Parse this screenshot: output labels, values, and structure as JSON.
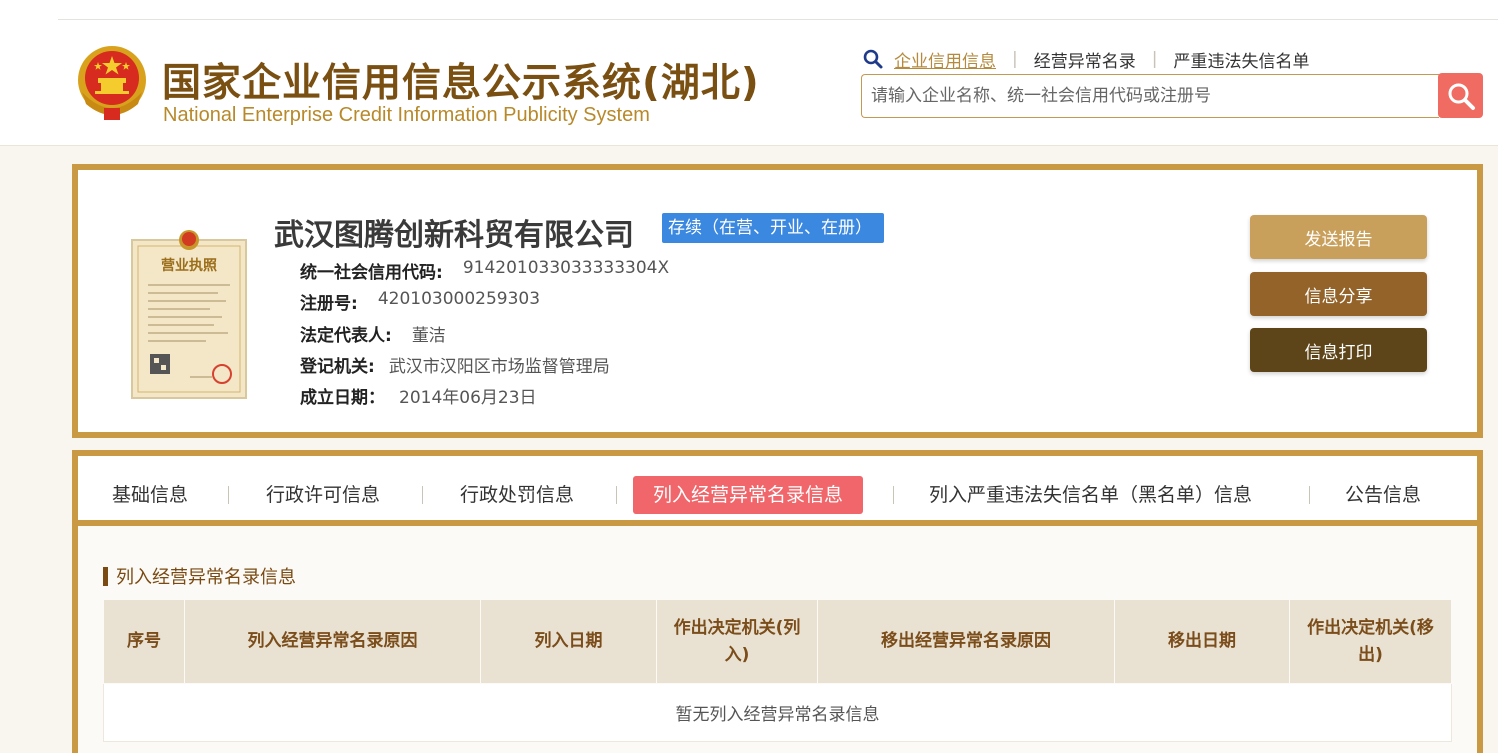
{
  "header": {
    "title": "国家企业信用信息公示系统(湖北)",
    "subtitle": "National Enterprise Credit Information Publicity System",
    "links": [
      {
        "label": "企业信用信息",
        "active": true
      },
      {
        "label": "经营异常名录",
        "active": false
      },
      {
        "label": "严重违法失信名单",
        "active": false
      }
    ],
    "search_placeholder": "请输入企业名称、统一社会信用代码或注册号"
  },
  "company": {
    "name": "武汉图腾创新科贸有限公司",
    "status": "存续（在营、开业、在册）",
    "fields": [
      {
        "label": "统一社会信用代码:",
        "value": "914201033033333304X"
      },
      {
        "label": "注册号:",
        "value": "420103000259303"
      },
      {
        "label": "法定代表人:",
        "value": "董洁"
      },
      {
        "label": "登记机关:",
        "value": "武汉市汉阳区市场监督管理局"
      },
      {
        "label": "成立日期：",
        "value": "2014年06月23日"
      }
    ],
    "license_card": {
      "title": "营业执照"
    }
  },
  "actions": {
    "send_report": "发送报告",
    "share": "信息分享",
    "print": "信息打印"
  },
  "tabs": [
    {
      "label": "基础信息",
      "active": false
    },
    {
      "label": "行政许可信息",
      "active": false
    },
    {
      "label": "行政处罚信息",
      "active": false
    },
    {
      "label": "列入经营异常名录信息",
      "active": true
    },
    {
      "label": "列入严重违法失信名单（黑名单）信息",
      "active": false
    },
    {
      "label": "公告信息",
      "active": false
    }
  ],
  "section": {
    "title": "列入经营异常名录信息",
    "columns": [
      "序号",
      "列入经营异常名录原因",
      "列入日期",
      "作出决定机关(列入)",
      "移出经营异常名录原因",
      "移出日期",
      "作出决定机关(移出)"
    ],
    "empty_message": "暂无列入经营异常名录信息"
  },
  "colors": {
    "brand_gold": "#c99a43",
    "title_brown": "#7a4f12",
    "status_blue": "#3b88e0",
    "search_red": "#f06b61",
    "active_tab": "#f0666a",
    "btn_send": "#c9a05b",
    "btn_share": "#93632a",
    "btn_print": "#5e4519"
  },
  "icons": {
    "emblem": "national-emblem-icon",
    "search": "search-icon",
    "link_search": "magnifier-icon"
  }
}
